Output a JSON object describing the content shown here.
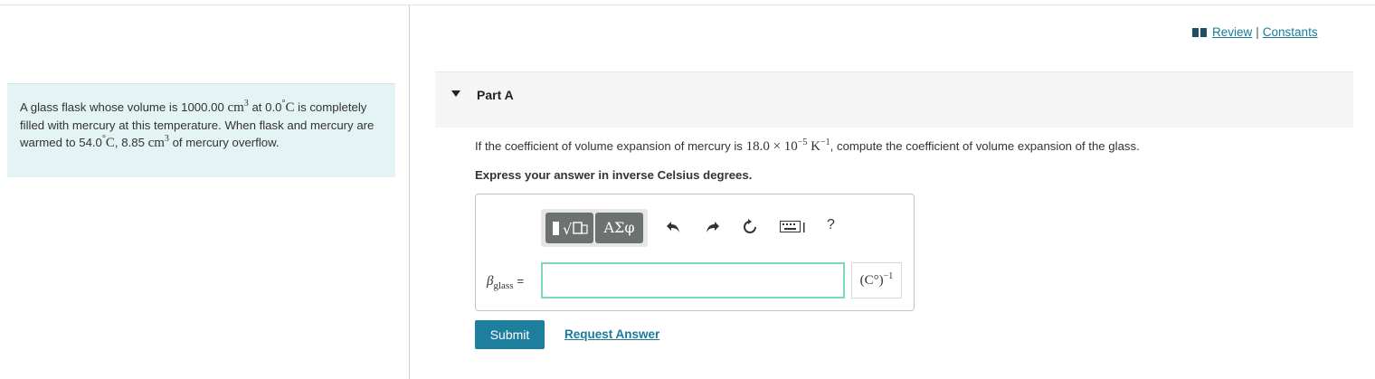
{
  "problem": {
    "t1": "A glass flask whose volume is 1000.00 ",
    "m1": "cm",
    "m1_sup": "3",
    "t2": " at 0.0",
    "m2_sup": "°",
    "m2": "C",
    "t3": " is completely filled with mercury at this temperature. When flask and mercury are warmed to 54.0",
    "m3_sup": "°",
    "m3": "C",
    "t4": ", 8.85 ",
    "m4": "cm",
    "m4_sup": "3",
    "t5": " of mercury overflow."
  },
  "links": {
    "review": "Review",
    "separator": "|",
    "constants": "Constants"
  },
  "part": {
    "label": "Part A"
  },
  "question": {
    "t1": "If the coefficient of volume expansion of mercury is ",
    "m1": "18.0 × 10",
    "m1_sup": "−5",
    "m2": " K",
    "m2_sup": "−1",
    "t2": ", compute the coefficient of volume expansion of the glass."
  },
  "instruction": "Express your answer in inverse Celsius degrees.",
  "toolbar": {
    "templates_label": "√",
    "symbols_label": "ΑΣφ",
    "help_label": "?"
  },
  "answer": {
    "variable": "β",
    "variable_sub": "glass",
    "equals": "=",
    "input_value": "",
    "units": "(C°)",
    "units_sup": "−1"
  },
  "actions": {
    "submit": "Submit",
    "request": "Request Answer"
  },
  "colors": {
    "accent": "#1e7e9e",
    "problem_bg": "#e4f3f4",
    "input_focus": "#7bd9b4"
  },
  "icons": [
    "book-icon",
    "undo-icon",
    "redo-icon",
    "reset-icon",
    "keyboard-icon",
    "help-icon",
    "collapse-caret-icon"
  ]
}
